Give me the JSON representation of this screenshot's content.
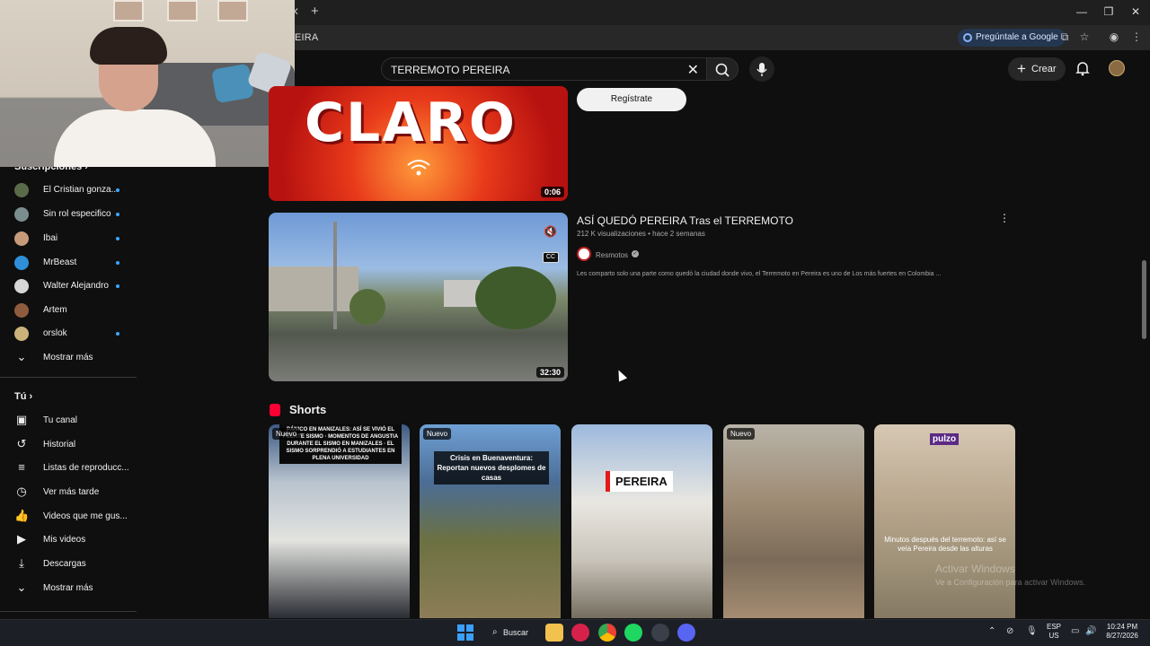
{
  "browser": {
    "url_fragment": "EIRA",
    "ask_google_label": "Pregúntale a Google"
  },
  "youtube": {
    "search": {
      "value": "TERREMOTO PEREIRA"
    },
    "create_label": "Crear"
  },
  "sidebar": {
    "subscriptions_title": "Suscripciones",
    "subscriptions": [
      {
        "label": "El Cristian gonza...",
        "color": "#5a6b4a",
        "dot": true
      },
      {
        "label": "Sin rol especifico",
        "color": "#7b8d8f",
        "dot": true
      },
      {
        "label": "Ibai",
        "color": "#c79a7a",
        "dot": true
      },
      {
        "label": "MrBeast",
        "color": "#2f8fd8",
        "dot": true
      },
      {
        "label": "Walter Alejandro",
        "color": "#d6d6d6",
        "dot": true
      },
      {
        "label": "Artem",
        "color": "#8f5b3e",
        "dot": false
      },
      {
        "label": "orslok",
        "color": "#c9b37a",
        "dot": true
      }
    ],
    "show_more_1": "Mostrar más",
    "you_title": "Tú",
    "you_items": [
      {
        "label": "Tu canal",
        "icon": "user-square-icon"
      },
      {
        "label": "Historial",
        "icon": "history-icon"
      },
      {
        "label": "Listas de reproducc...",
        "icon": "playlist-icon"
      },
      {
        "label": "Ver más tarde",
        "icon": "clock-icon"
      },
      {
        "label": "Videos que me gus...",
        "icon": "thumbs-up-icon"
      },
      {
        "label": "Mis videos",
        "icon": "video-icon"
      },
      {
        "label": "Descargas",
        "icon": "download-icon"
      }
    ],
    "show_more_2": "Mostrar más"
  },
  "feed": {
    "ad": {
      "thumb_text": "CLARO",
      "duration": "0:06",
      "button_label": "Regístrate"
    },
    "video": {
      "title": "ASÍ QUEDÓ PEREIRA Tras el TERREMOTO",
      "meta": "212 K visualizaciones • hace 2 semanas",
      "channel": "Resmotos",
      "description": "Les comparto solo una parte como quedó la ciudad donde vivo, el Terremoto en Pereira es uno de Los más fuertes en Colombia ...",
      "duration": "32:30",
      "cc_label": "CC"
    },
    "shorts_title": "Shorts",
    "shorts": [
      {
        "badge": "Nuevo",
        "caption": "PÁNICO EN MANIZALES: ASÍ SE VIVIÓ EL FUERTE SISMO · MOMENTOS DE ANGUSTIA DURANTE EL SISMO EN MANIZALES · EL SISMO SORPRENDIÓ A ESTUDIANTES EN PLENA UNIVERSIDAD"
      },
      {
        "badge": "Nuevo",
        "caption": "Crisis en Buenaventura: Reportan nuevos desplomes de casas"
      },
      {
        "badge": "",
        "caption": "PEREIRA"
      },
      {
        "badge": "Nuevo",
        "caption": ""
      },
      {
        "badge": "",
        "logo": "pulzo",
        "caption": "Minutos después del terremoto: así se veía Pereira desde las alturas"
      }
    ],
    "activate_windows": {
      "line1": "Activar Windows",
      "line2": "Ve a Configuración para activar Windows."
    }
  },
  "taskbar": {
    "search_label": "Buscar",
    "lang": "ESP",
    "region": "US",
    "time": "10:24 PM",
    "date": "8/27/2026"
  }
}
